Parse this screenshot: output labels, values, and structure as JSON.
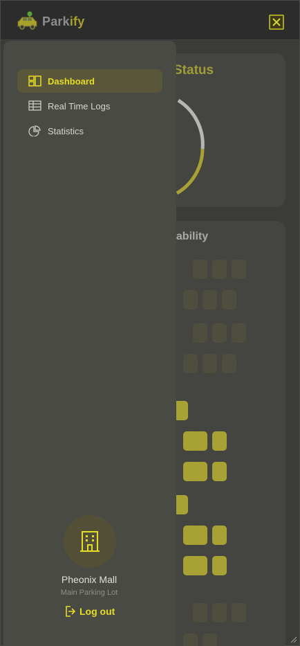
{
  "app": {
    "brand_part1": "Park",
    "brand_part2": "ify",
    "accent_color": "#e6dd25",
    "logo_icon": "car-location-icon",
    "close_icon": "close-box-icon"
  },
  "main": {
    "status_card": {
      "title_visible": "Status"
    },
    "availability_card": {
      "title_visible": "ilability"
    }
  },
  "drawer": {
    "items": [
      {
        "label": "Dashboard",
        "icon": "dashboard-icon",
        "active": true
      },
      {
        "label": "Real Time Logs",
        "icon": "table-icon",
        "active": false
      },
      {
        "label": "Statistics",
        "icon": "pie-chart-icon",
        "active": false
      }
    ],
    "location": {
      "icon": "building-icon",
      "name": "Pheonix Mall",
      "subtitle": "Main Parking Lot"
    },
    "logout_label": "Log out",
    "logout_icon": "logout-icon"
  }
}
